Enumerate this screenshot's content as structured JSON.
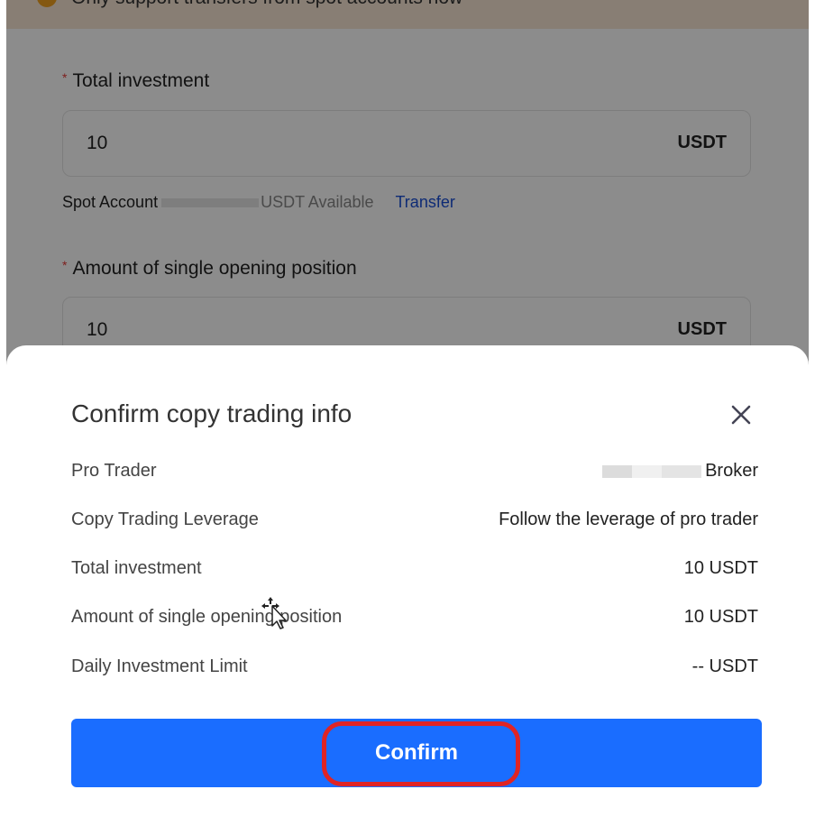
{
  "notice": {
    "text": "Only support transfers from spot accounts now",
    "icon": "warning-icon"
  },
  "form": {
    "total_investment": {
      "label": "Total investment",
      "value": "10",
      "unit": "USDT"
    },
    "spot_account": {
      "label": "Spot Account",
      "unit_available": "USDT Available",
      "transfer_label": "Transfer"
    },
    "single_position": {
      "label": "Amount of single opening position",
      "value": "10",
      "unit": "USDT"
    }
  },
  "dialog": {
    "title": "Confirm copy trading info",
    "rows": [
      {
        "label": "Pro Trader",
        "value": "Broker"
      },
      {
        "label": "Copy Trading Leverage",
        "value": "Follow the leverage of pro trader"
      },
      {
        "label": "Total investment",
        "value": "10 USDT"
      },
      {
        "label": "Amount of single opening position",
        "value": "10 USDT"
      },
      {
        "label": "Daily Investment Limit",
        "value": "-- USDT"
      }
    ],
    "confirm_label": "Confirm"
  },
  "colors": {
    "primary": "#1a6dff",
    "highlight": "#e02424",
    "link": "#1a4fd6",
    "required": "#e53935"
  }
}
